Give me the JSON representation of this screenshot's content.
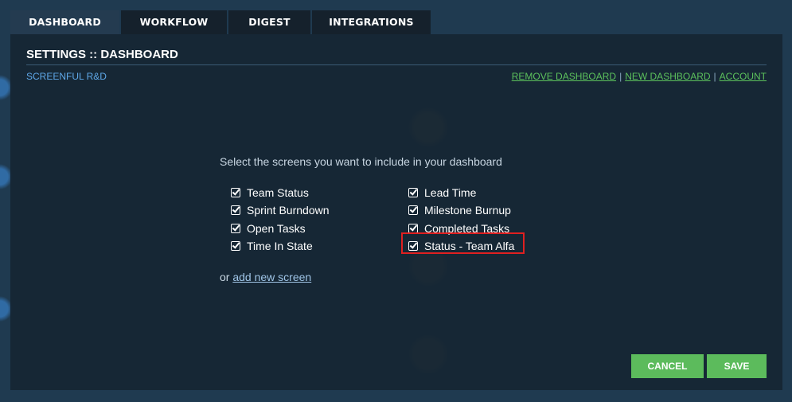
{
  "tabs": [
    {
      "label": "DASHBOARD",
      "active": true
    },
    {
      "label": "WORKFLOW",
      "active": false
    },
    {
      "label": "DIGEST",
      "active": false
    },
    {
      "label": "INTEGRATIONS",
      "active": false
    }
  ],
  "panel": {
    "title": "SETTINGS :: DASHBOARD",
    "org_name": "SCREENFUL R&D",
    "links": {
      "remove": "REMOVE DASHBOARD",
      "separator": "|",
      "new": "NEW DASHBOARD",
      "account": "ACCOUNT"
    },
    "prompt": "Select the screens you want to include in your dashboard",
    "screens_left": [
      {
        "label": "Team Status",
        "checked": true
      },
      {
        "label": "Sprint Burndown",
        "checked": true
      },
      {
        "label": "Open Tasks",
        "checked": true
      },
      {
        "label": "Time In State",
        "checked": true
      }
    ],
    "screens_right": [
      {
        "label": "Lead Time",
        "checked": true
      },
      {
        "label": "Milestone Burnup",
        "checked": true
      },
      {
        "label": "Completed Tasks",
        "checked": true
      },
      {
        "label": "Status - Team Alfa",
        "checked": true
      }
    ],
    "add_prefix": "or",
    "add_link": "add new screen",
    "buttons": {
      "cancel": "CANCEL",
      "save": "SAVE"
    }
  },
  "colors": {
    "accent_green": "#5cbb5c",
    "link_blue": "#5fa8e8",
    "highlight_red": "#e02020"
  }
}
